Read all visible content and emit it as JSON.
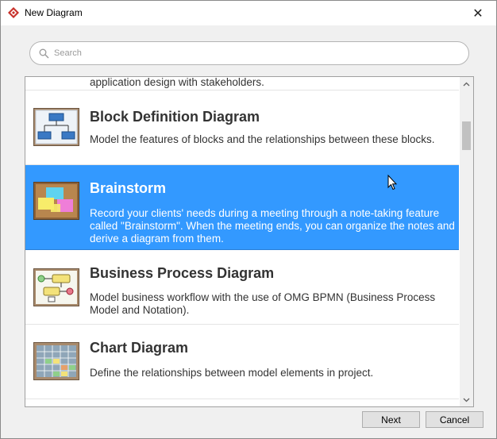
{
  "window": {
    "title": "New Diagram",
    "close_glyph": "✕",
    "app_icon": "visual-paradigm-icon"
  },
  "search": {
    "placeholder": "Search",
    "value": "",
    "icon": "search-icon"
  },
  "list": {
    "partial_item_description": "application design with stakeholders.",
    "items": [
      {
        "name": "Block Definition Diagram",
        "description": "Model the features of blocks and the relationships between these blocks.",
        "icon": "block-definition-diagram-icon",
        "selected": false
      },
      {
        "name": "Brainstorm",
        "description": "Record your clients' needs during a meeting through a note-taking feature called \"Brainstorm\". When the meeting ends, you can organize the notes and derive a diagram from them.",
        "icon": "brainstorm-icon",
        "selected": true
      },
      {
        "name": "Business Process Diagram",
        "description": "Model business workflow with the use of OMG BPMN (Business Process Model and Notation).",
        "icon": "business-process-diagram-icon",
        "selected": false
      },
      {
        "name": "Chart Diagram",
        "description": "Define the relationships between model elements in project.",
        "icon": "chart-diagram-icon",
        "selected": false
      }
    ]
  },
  "buttons": {
    "next": "Next",
    "cancel": "Cancel"
  },
  "colors": {
    "selection": "#3399ff",
    "brand": "#c8312b"
  }
}
